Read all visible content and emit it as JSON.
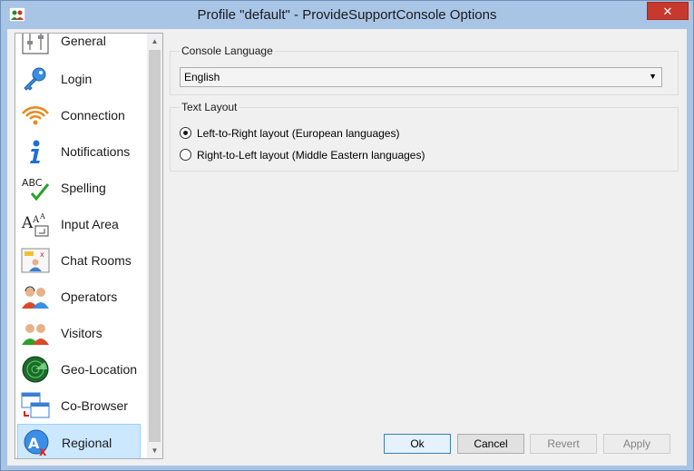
{
  "window": {
    "title": "Profile \"default\" - ProvideSupportConsole Options",
    "close_label": "✕"
  },
  "sidebar": {
    "items": [
      {
        "label": "General",
        "icon": "sliders-icon"
      },
      {
        "label": "Login",
        "icon": "key-icon"
      },
      {
        "label": "Connection",
        "icon": "signal-icon"
      },
      {
        "label": "Notifications",
        "icon": "info-icon"
      },
      {
        "label": "Spelling",
        "icon": "spellcheck-icon"
      },
      {
        "label": "Input Area",
        "icon": "font-size-icon"
      },
      {
        "label": "Chat Rooms",
        "icon": "chat-room-icon"
      },
      {
        "label": "Operators",
        "icon": "operators-icon"
      },
      {
        "label": "Visitors",
        "icon": "visitors-icon"
      },
      {
        "label": "Geo-Location",
        "icon": "radar-icon"
      },
      {
        "label": "Co-Browser",
        "icon": "cobrowser-icon"
      },
      {
        "label": "Regional",
        "icon": "regional-icon"
      }
    ],
    "selected": "Regional"
  },
  "console_language": {
    "group_label": "Console Language",
    "selected": "English"
  },
  "text_layout": {
    "group_label": "Text Layout",
    "options": [
      {
        "label": "Left-to-Right layout (European languages)",
        "checked": true
      },
      {
        "label": "Right-to-Left layout (Middle Eastern languages)",
        "checked": false
      }
    ]
  },
  "buttons": {
    "ok": "Ok",
    "cancel": "Cancel",
    "revert": "Revert",
    "apply": "Apply"
  }
}
